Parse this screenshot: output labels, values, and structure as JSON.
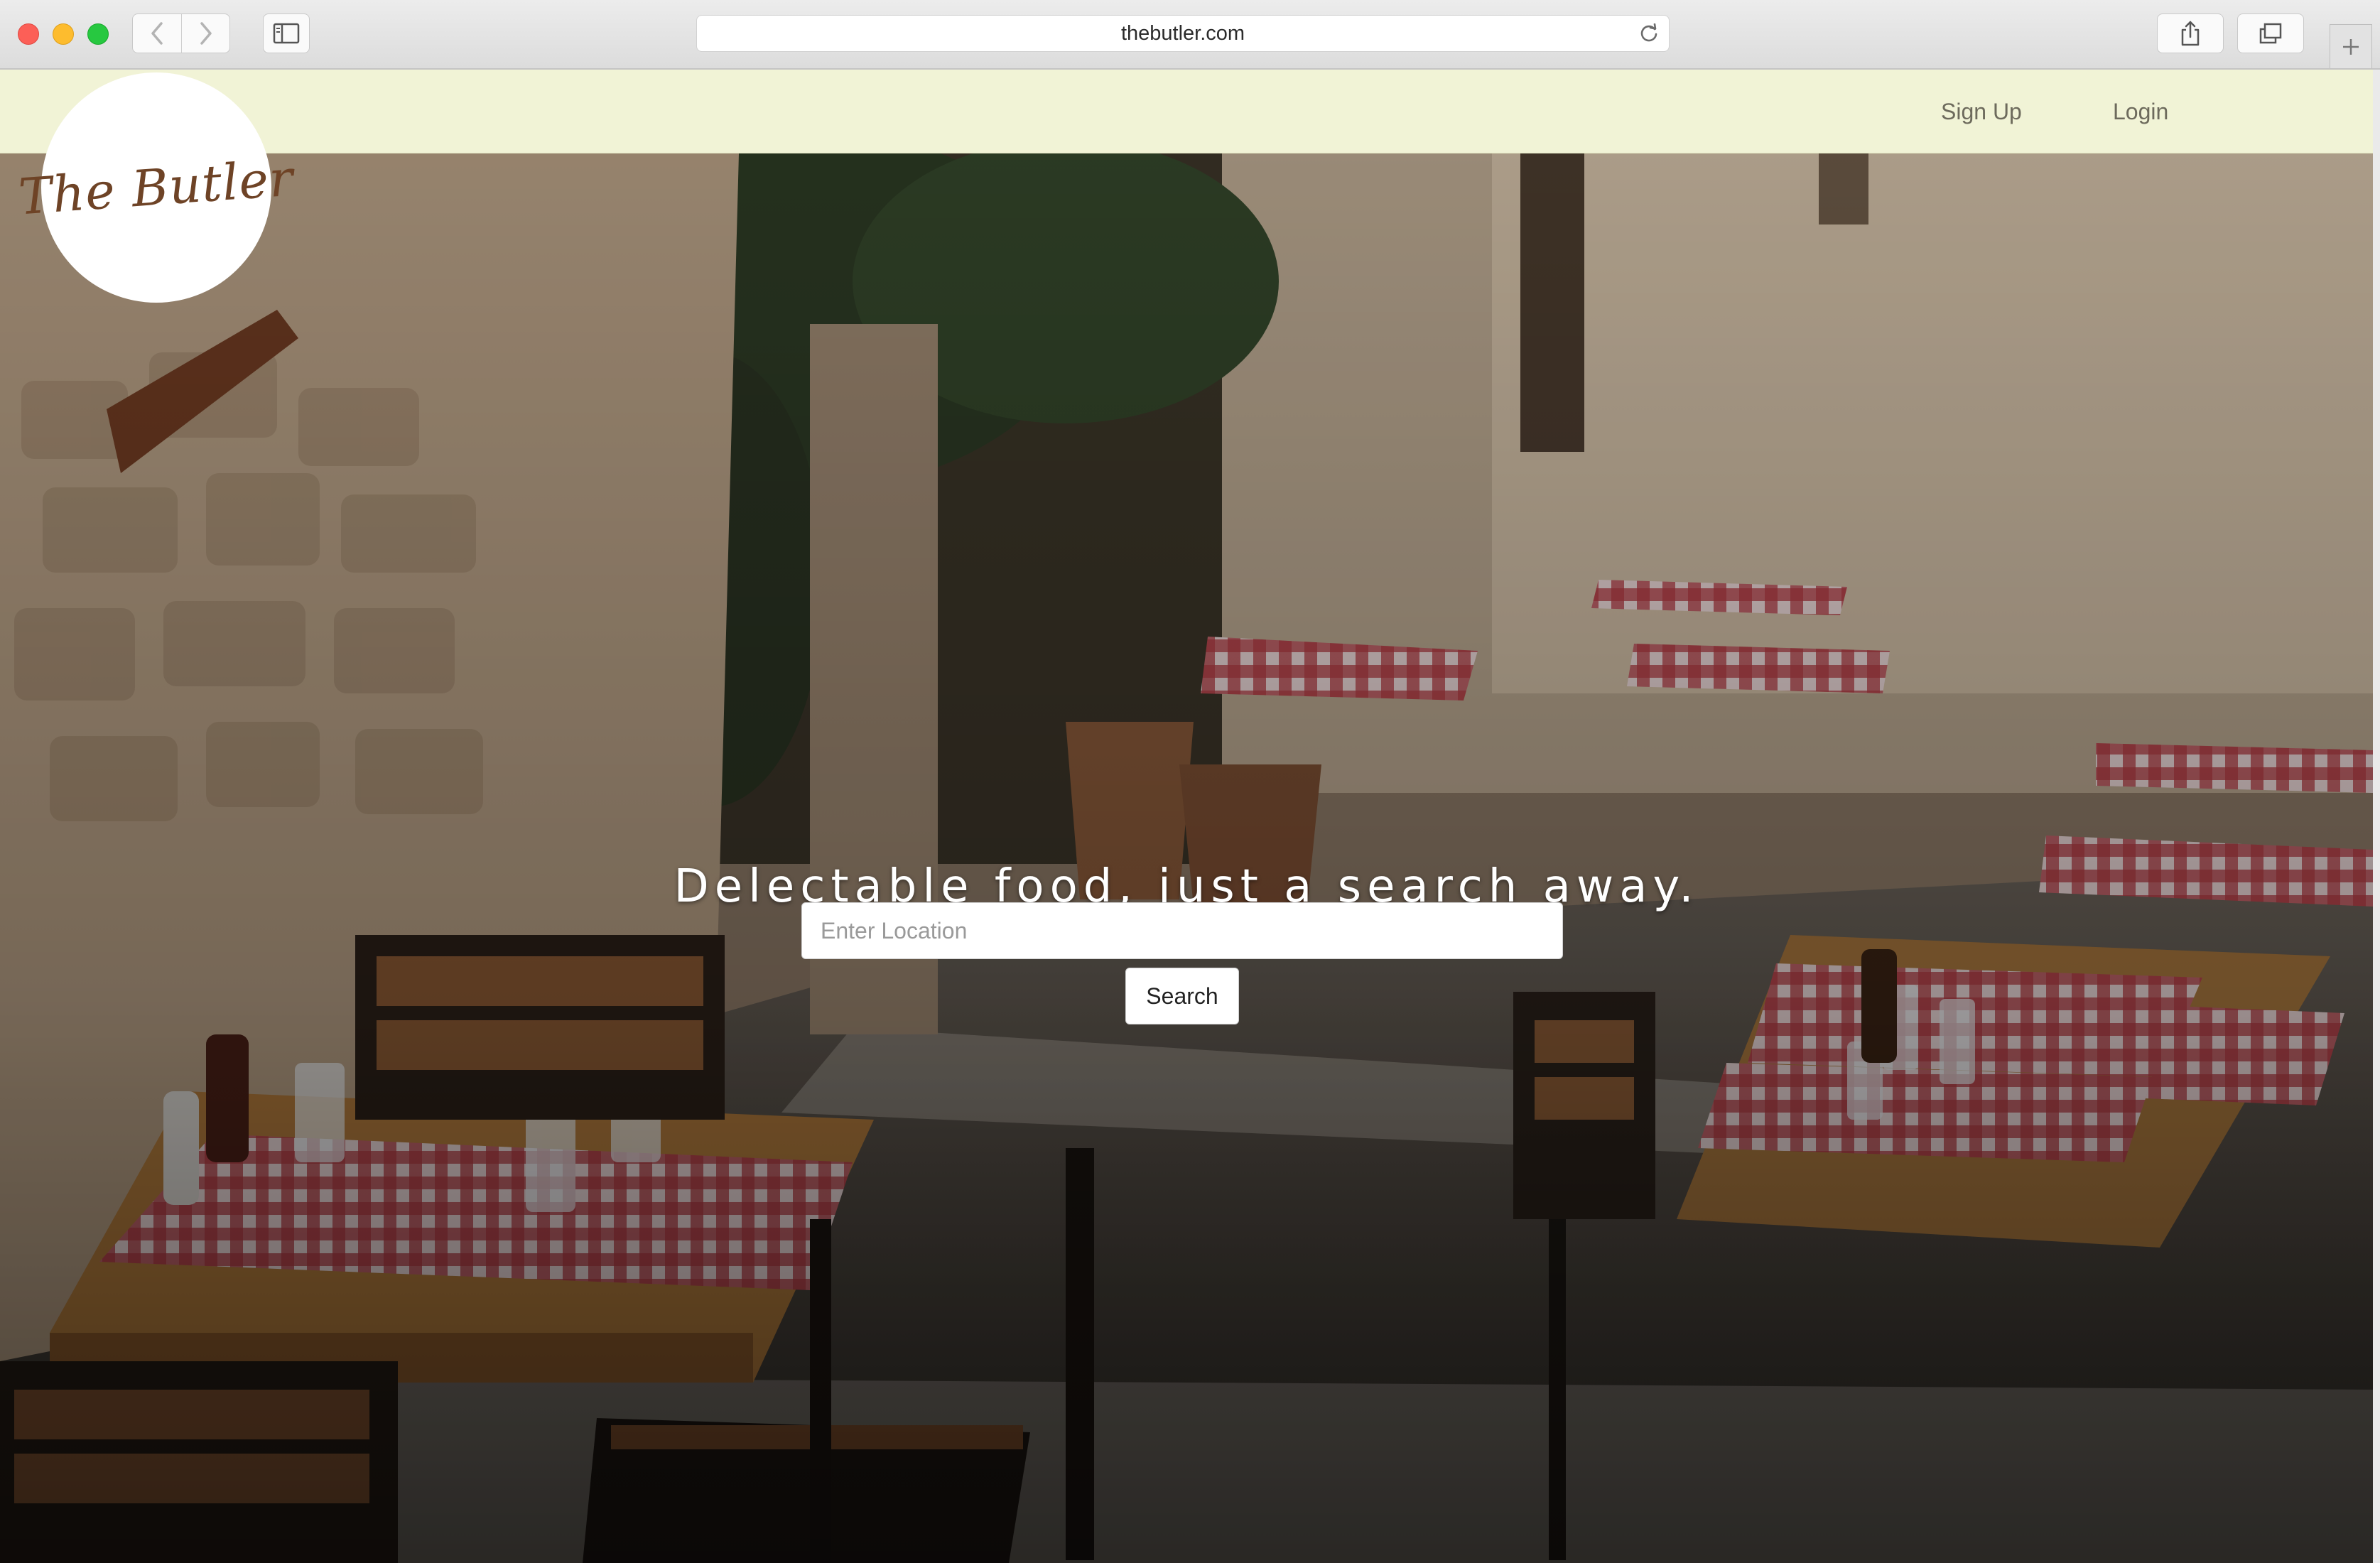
{
  "browser": {
    "url": "thebutler.com",
    "controls": {
      "back": "chevron-left-icon",
      "forward": "chevron-right-icon",
      "sidebar": "sidebar-icon",
      "reload": "reload-icon",
      "share": "share-icon",
      "tabs": "tabs-icon",
      "new_tab": "plus-icon"
    }
  },
  "site": {
    "logo_text": "The Butler",
    "nav": {
      "signup": "Sign Up",
      "login": "Login"
    },
    "hero": {
      "headline": "Delectable food, just a search away.",
      "search_placeholder": "Enter Location",
      "search_value": "",
      "search_button": "Search"
    }
  },
  "colors": {
    "nav_bar": "#f1f3d6",
    "logo_brown": "#6e4326",
    "nav_link": "#6d6a5c"
  }
}
